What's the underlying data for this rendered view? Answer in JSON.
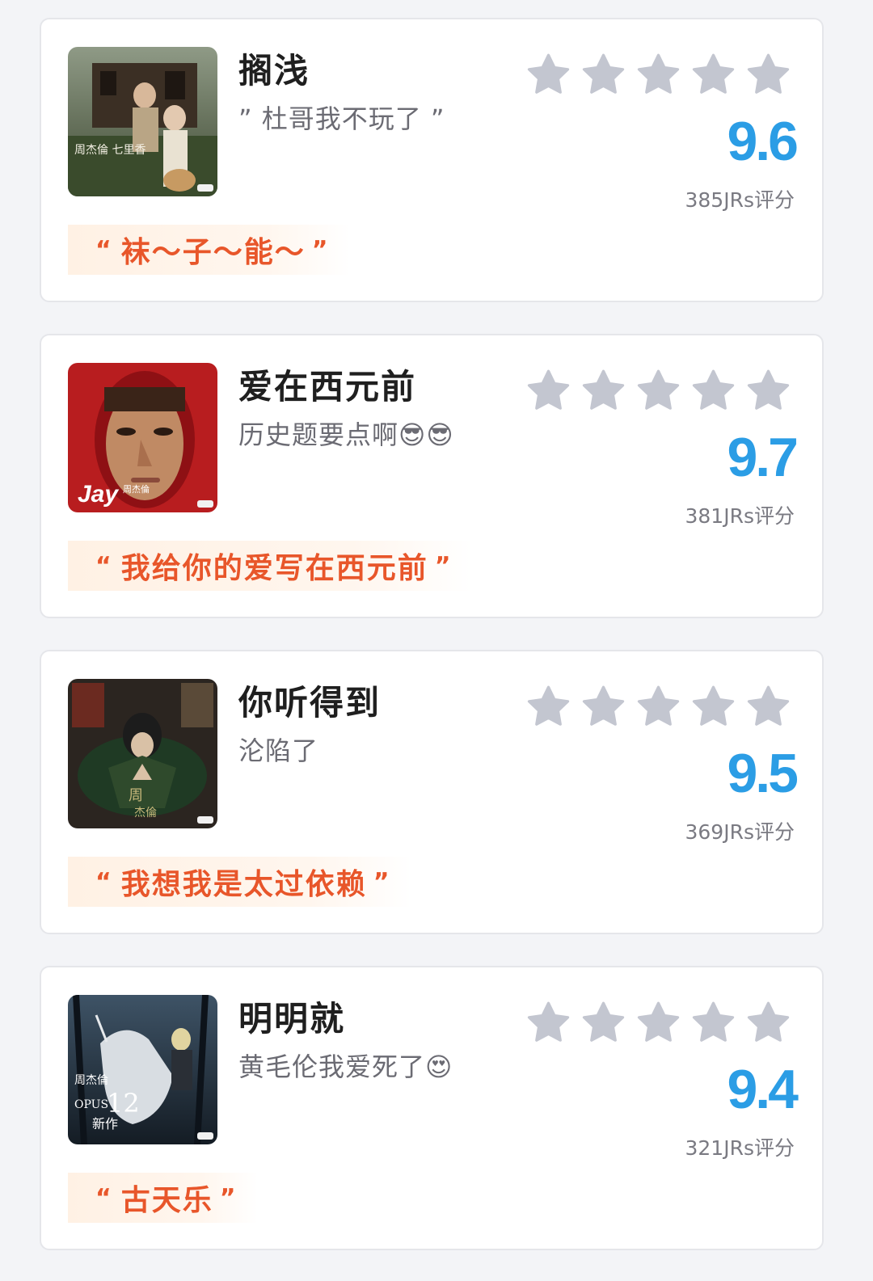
{
  "songs": [
    {
      "title": "搁浅",
      "comment": "” 杜哥我不玩了 ”",
      "rating_stars": 5,
      "score": "9.6",
      "votes": "385JRs评分",
      "quote_open": "“",
      "quote": "袜～子～能～",
      "quote_close": "”",
      "cover_icon": "album-cover-qilixiang"
    },
    {
      "title": "爱在西元前",
      "comment": "历史题要点啊😎😎",
      "rating_stars": 5,
      "score": "9.7",
      "votes": "381JRs评分",
      "quote_open": "“",
      "quote": "我给你的爱写在西元前",
      "quote_close": "”",
      "cover_icon": "album-cover-jay"
    },
    {
      "title": "你听得到",
      "comment": "沦陷了",
      "rating_stars": 5,
      "score": "9.5",
      "votes": "369JRs评分",
      "quote_open": "“",
      "quote": "我想我是太过依赖",
      "quote_close": "”",
      "cover_icon": "album-cover-ye-huimei"
    },
    {
      "title": "明明就",
      "comment": "黄毛伦我爱死了😍",
      "rating_stars": 5,
      "score": "9.4",
      "votes": "321JRs评分",
      "quote_open": "“",
      "quote": "古天乐",
      "quote_close": "”",
      "cover_icon": "album-cover-opus-12"
    }
  ],
  "colors": {
    "star": "#c3c6d0",
    "score": "#2b9de5",
    "quote_text": "#e8562a",
    "quote_bg": "#fff1e4"
  }
}
